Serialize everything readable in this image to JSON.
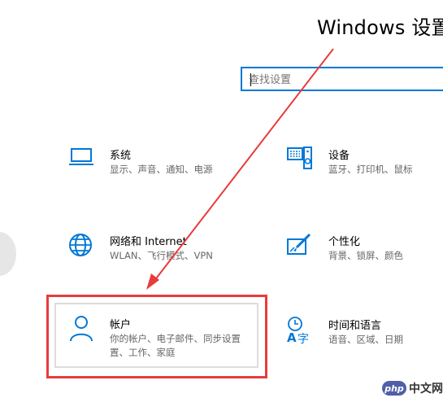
{
  "window": {
    "title": "Windows 设置"
  },
  "search": {
    "placeholder": "查找设置"
  },
  "tiles": [
    {
      "name": "系统",
      "desc": "显示、声音、通知、电源",
      "icon": "laptop-icon"
    },
    {
      "name": "设备",
      "desc": "蓝牙、打印机、鼠标",
      "icon": "keyboard-speaker-icon"
    },
    {
      "name": "网络和 Internet",
      "desc": "WLAN、飞行模式、VPN",
      "icon": "globe-icon"
    },
    {
      "name": "个性化",
      "desc": "背景、锁屏、颜色",
      "icon": "paint-brush-icon"
    },
    {
      "name": "帐户",
      "desc_line1": "你的帐户、电子邮件、同步设置",
      "desc_line2": "置、工作、家庭",
      "icon": "person-icon"
    },
    {
      "name": "时间和语言",
      "desc": "语音、区域、日期",
      "icon": "time-language-icon"
    }
  ],
  "watermark": {
    "badge": "php",
    "text": "中文网"
  },
  "colors": {
    "accent": "#0078d7",
    "highlight": "#e83b3b"
  }
}
